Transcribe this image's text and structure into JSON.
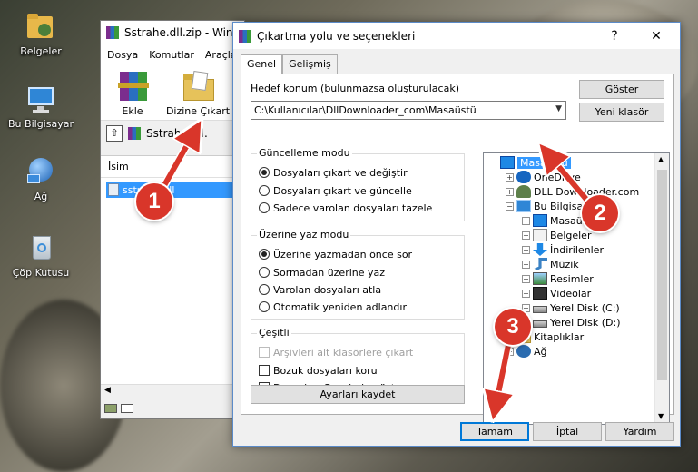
{
  "desktop": {
    "icons": [
      {
        "label": "Belgeler",
        "icon": "documents-folder-icon"
      },
      {
        "label": "Bu Bilgisayar",
        "icon": "computer-icon"
      },
      {
        "label": "Ağ",
        "icon": "network-icon"
      },
      {
        "label": "Çöp Kutusu",
        "icon": "recycle-bin-icon"
      }
    ]
  },
  "winrar": {
    "title": "Sstrahe.dll.zip - Win",
    "menu": [
      "Dosya",
      "Komutlar",
      "Araçla"
    ],
    "toolbar": {
      "add_label": "Ekle",
      "extract_label": "Dizine Çıkart"
    },
    "path": "Sstrahe.dll.",
    "list_header": "İsim",
    "selected_file": "sstrahe.dll"
  },
  "dialog": {
    "title": "Çıkartma yolu ve seçenekleri",
    "help_glyph": "?",
    "close_glyph": "✕",
    "tabs": [
      "Genel",
      "Gelişmiş"
    ],
    "dest_label": "Hedef konum (bulunmazsa oluşturulacak)",
    "dest_value": "C:\\Kullanıcılar\\DllDownloader_com\\Masaüstü",
    "show_button": "Göster",
    "new_folder_button": "Yeni klasör",
    "update_group": {
      "title": "Güncelleme modu",
      "options": [
        "Dosyaları çıkart ve değiştir",
        "Dosyaları çıkart ve güncelle",
        "Sadece varolan dosyaları tazele"
      ],
      "selected": 0
    },
    "overwrite_group": {
      "title": "Üzerine yaz modu",
      "options": [
        "Üzerine yazmadan önce sor",
        "Sormadan üzerine yaz",
        "Varolan dosyaları atla",
        "Otomatik yeniden adlandır"
      ],
      "selected": 0
    },
    "misc_group": {
      "title": "Çeşitli",
      "options": [
        {
          "label": "Arşivleri alt klasörlere çıkart",
          "checked": false,
          "disabled": true
        },
        {
          "label": "Bozuk dosyaları koru",
          "checked": false,
          "disabled": false
        },
        {
          "label": "Dosyaları Gezginde göster",
          "checked": false,
          "disabled": false
        }
      ]
    },
    "save_settings_button": "Ayarları kaydet",
    "tree": [
      {
        "label": "Masaüstü",
        "level": 0,
        "expander": "",
        "icon": "desktop-icon",
        "selected": true
      },
      {
        "label": "OneDrive",
        "level": 1,
        "expander": "+",
        "icon": "onedrive-cloud-icon",
        "selected": false
      },
      {
        "label": "DLL Downloader.com",
        "level": 1,
        "expander": "+",
        "icon": "user-icon",
        "selected": false
      },
      {
        "label": "Bu Bilgisayar",
        "level": 1,
        "expander": "−",
        "icon": "computer-icon",
        "selected": false
      },
      {
        "label": "Masaüstü",
        "level": 2,
        "expander": "+",
        "icon": "desktop-icon",
        "selected": false
      },
      {
        "label": "Belgeler",
        "level": 2,
        "expander": "+",
        "icon": "documents-icon",
        "selected": false
      },
      {
        "label": "İndirilenler",
        "level": 2,
        "expander": "+",
        "icon": "downloads-icon",
        "selected": false
      },
      {
        "label": "Müzik",
        "level": 2,
        "expander": "+",
        "icon": "music-icon",
        "selected": false
      },
      {
        "label": "Resimler",
        "level": 2,
        "expander": "+",
        "icon": "pictures-icon",
        "selected": false
      },
      {
        "label": "Videolar",
        "level": 2,
        "expander": "+",
        "icon": "videos-icon",
        "selected": false
      },
      {
        "label": "Yerel Disk (C:)",
        "level": 2,
        "expander": "+",
        "icon": "drive-icon",
        "selected": false
      },
      {
        "label": "Yerel Disk (D:)",
        "level": 2,
        "expander": "+",
        "icon": "drive-icon",
        "selected": false
      },
      {
        "label": "Kitaplıklar",
        "level": 1,
        "expander": "+",
        "icon": "library-folder-icon",
        "selected": false
      },
      {
        "label": "Ağ",
        "level": 1,
        "expander": "+",
        "icon": "network-icon",
        "selected": false
      }
    ],
    "ok_button": "Tamam",
    "cancel_button": "İptal",
    "help_button": "Yardım"
  },
  "annotations": [
    "1",
    "2",
    "3"
  ],
  "colors": {
    "annotation": "#d9362a",
    "selection": "#3399ff",
    "accent": "#0078d7"
  }
}
